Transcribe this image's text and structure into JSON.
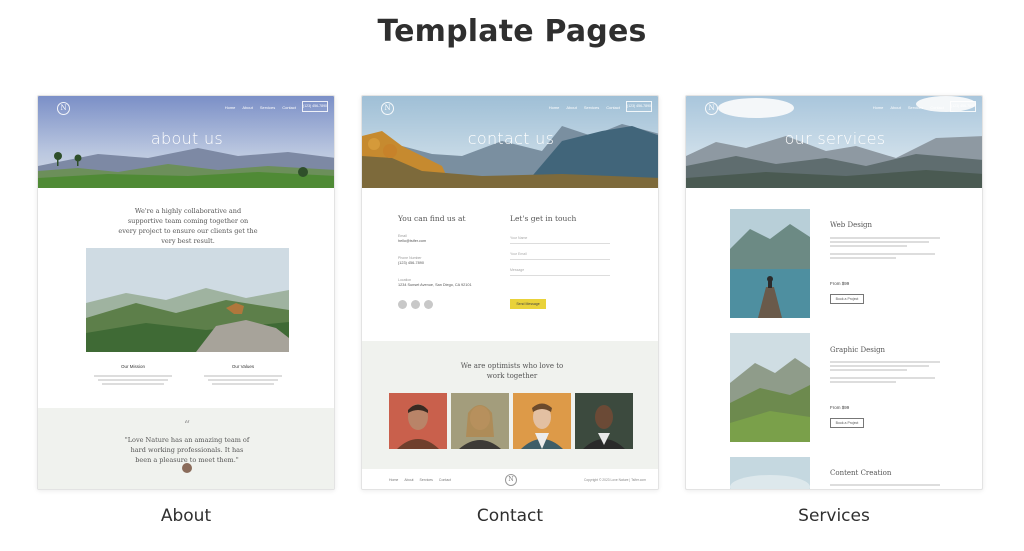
{
  "page_title": "Template Pages",
  "nav": {
    "items": [
      "Home",
      "About",
      "Services",
      "Contact"
    ],
    "cta": "(123) 456-7890"
  },
  "logo_letter": "N",
  "cards": {
    "about": {
      "caption": "About",
      "hero_title": "about us",
      "intro": "We're a highly collaborative and supportive team coming together on every project to ensure our clients get the very best result.",
      "col1_title": "Our Mission",
      "col2_title": "Our Values",
      "quote_mark": "“",
      "quote": "\"Love Nature has an amazing team of hard working professionals. It has been a pleasure to meet them.\""
    },
    "contact": {
      "caption": "Contact",
      "hero_title": "contact us",
      "find_title": "You can find us at",
      "touch_title": "Let's get in touch",
      "email_label": "Email",
      "email_value": "hello@tsifer.com",
      "phone_label": "Phone Number",
      "phone_value": "(123) 456-7890",
      "location_label": "Location",
      "location_value": "1234 Sunset Avenue, San Diego, CA 92101",
      "field_name": "Your Name",
      "field_email": "Your Email",
      "field_message": "Message",
      "send_button": "Send Message",
      "team_title": "We are optimists who love to work together",
      "footer_links": [
        "Home",
        "About",
        "Services",
        "Contact"
      ],
      "footer_copy": "Copyright © 2023 Love Nature | Tsifer.com"
    },
    "services": {
      "caption": "Services",
      "hero_title": "our services",
      "service1_title": "Web Design",
      "service1_price": "From $99",
      "service1_button": "Book a Project",
      "service2_title": "Graphic Design",
      "service2_price": "From $99",
      "service2_button": "Book a Project",
      "service3_title": "Content Creation"
    }
  }
}
